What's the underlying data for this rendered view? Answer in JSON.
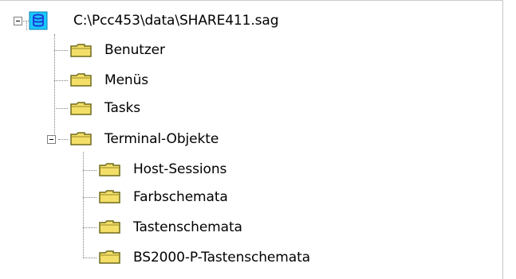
{
  "tree": {
    "root": {
      "label": "C:\\Pcc453\\data\\SHARE411.sag",
      "icon": "database-file-icon",
      "expanded": true,
      "children": [
        {
          "label": "Benutzer",
          "icon": "folder-icon"
        },
        {
          "label": "Menüs",
          "icon": "folder-icon"
        },
        {
          "label": "Tasks",
          "icon": "folder-icon"
        },
        {
          "label": "Terminal-Objekte",
          "icon": "folder-icon",
          "expanded": true,
          "children": [
            {
              "label": "Host-Sessions",
              "icon": "folder-icon"
            },
            {
              "label": "Farbschemata",
              "icon": "folder-icon"
            },
            {
              "label": "Tastenschemata",
              "icon": "folder-icon"
            },
            {
              "label": "BS2000-P-Tastenschemata",
              "icon": "folder-icon"
            }
          ]
        }
      ]
    }
  },
  "colors": {
    "background": "#ffffff",
    "folder_body": "#f3df68",
    "folder_outline": "#6f6a1c",
    "db_icon_bg": "#19c8ff",
    "db_icon_fg": "#1d3fd6",
    "tree_lines": "#7f7f7f"
  }
}
